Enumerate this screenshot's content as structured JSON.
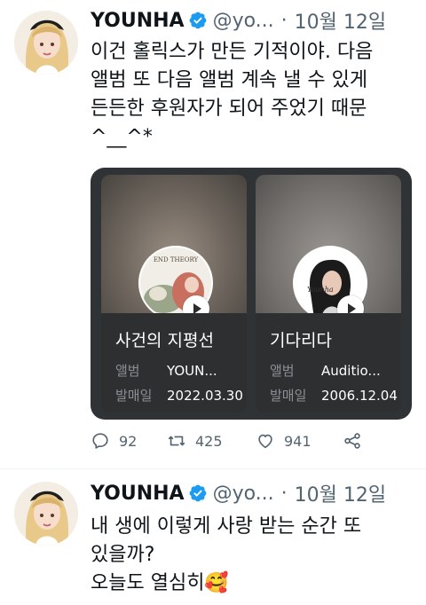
{
  "tweets": [
    {
      "name": "YOUNHA",
      "handle": "@yo...",
      "dot": "·",
      "date": "10월 12일",
      "lines": [
        "이건 홀릭스가 만든 기적이야. 다음",
        "앨범 또 다음 앨범 계속 낼 수 있게",
        "든든한 후원자가 되어 주었기 때문",
        "^__^*"
      ],
      "cards": [
        {
          "title": "사건의 지평선",
          "k1": "앨범",
          "v1": "YOUN...",
          "k2": "발매일",
          "v2": "2022.03.30",
          "art_text": "END THEORY"
        },
        {
          "title": "기다리다",
          "k1": "앨범",
          "v1": "Auditio...",
          "k2": "발매일",
          "v2": "2006.12.04",
          "art_text": "Younha"
        }
      ],
      "actions": {
        "reply": "92",
        "retweet": "425",
        "like": "941"
      }
    },
    {
      "name": "YOUNHA",
      "handle": "@yo...",
      "dot": "·",
      "date": "10월 12일",
      "lines": [
        "내 생에 이렇게 사랑 받는 순간 또",
        "있을까?",
        "오늘도 열심히🥰"
      ]
    }
  ],
  "colors": {
    "verified": "#1d9bf0",
    "muted": "#536471",
    "card_bg": "#2f3336"
  },
  "icons": [
    "verified-badge-icon",
    "reply-icon",
    "retweet-icon",
    "like-icon",
    "share-icon",
    "play-icon"
  ]
}
